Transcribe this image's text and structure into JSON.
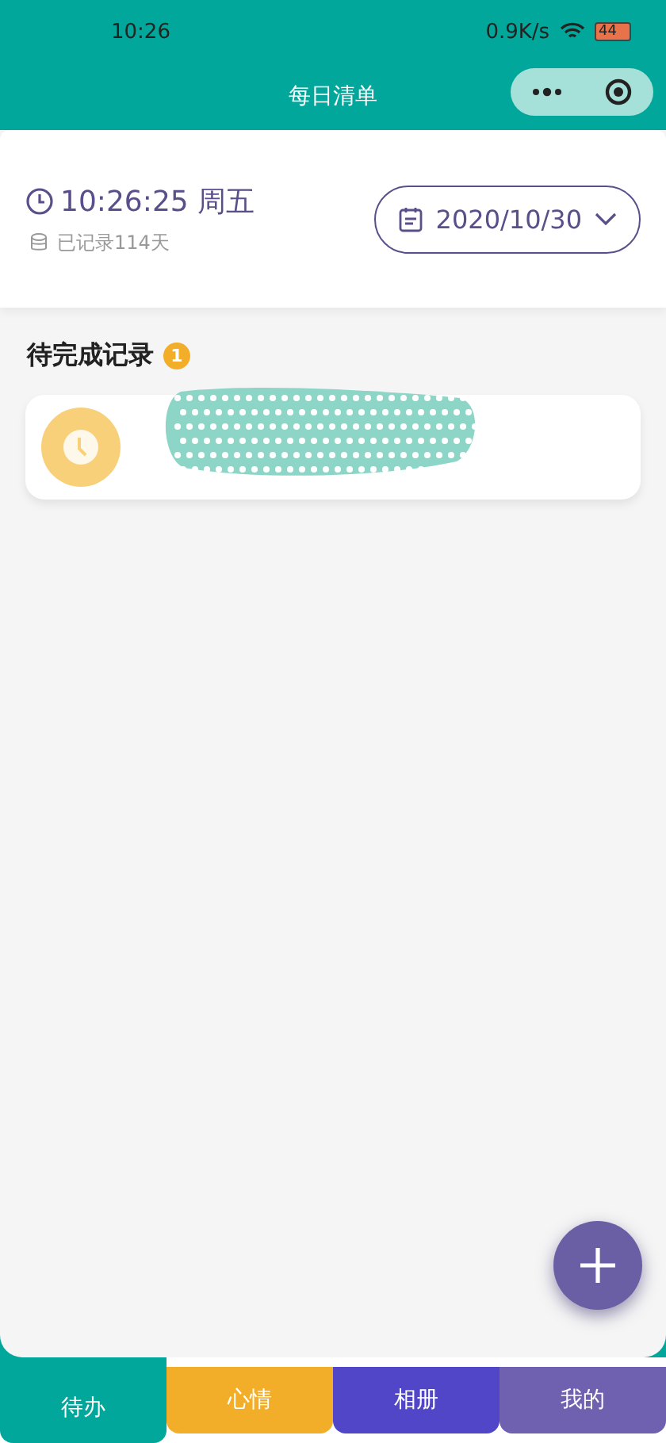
{
  "status_bar": {
    "time": "10:26",
    "speed": "0.9K/s",
    "battery": "44"
  },
  "nav": {
    "title": "每日清单"
  },
  "header": {
    "clock": "10:26:25 周五",
    "records": "已记录114天",
    "date": "2020/10/30"
  },
  "section": {
    "title": "待完成记录",
    "count": "1"
  },
  "tasks": [
    {
      "kind": "redacted"
    }
  ],
  "tabs": [
    {
      "label": "待办",
      "selected": true,
      "color": "#00a79a"
    },
    {
      "label": "心情",
      "selected": false,
      "color": "#f2ae28"
    },
    {
      "label": "相册",
      "selected": false,
      "color": "#5146c8"
    },
    {
      "label": "我的",
      "selected": false,
      "color": "#7060b0"
    }
  ]
}
